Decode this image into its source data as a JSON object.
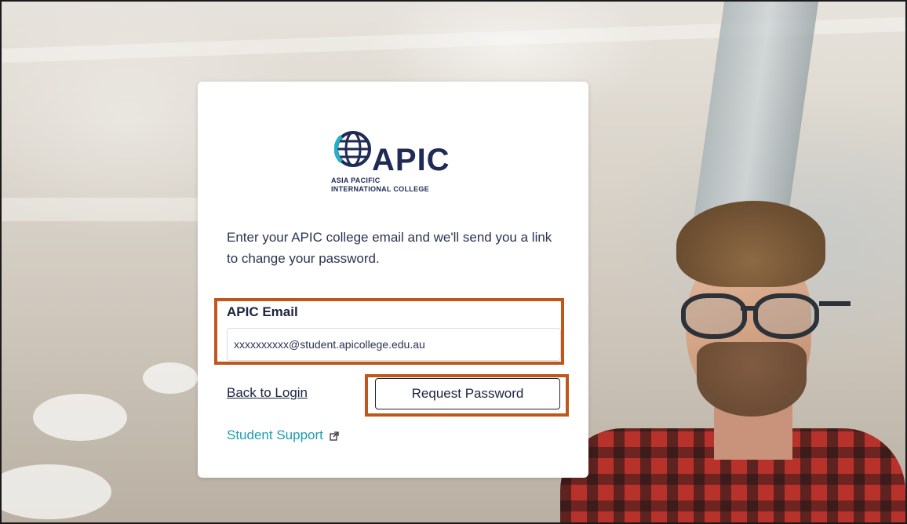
{
  "logo": {
    "wordmark": "APIC",
    "line1": "ASIA PACIFIC",
    "line2": "INTERNATIONAL COLLEGE",
    "icon": "globe-icon"
  },
  "instructions": "Enter your APIC college email and we'll send you a link to change your password.",
  "form": {
    "email_label": "APIC Email",
    "email_value": "xxxxxxxxxx@student.apicollege.edu.au"
  },
  "links": {
    "back_to_login": "Back to Login",
    "student_support": "Student Support",
    "external_icon": "external-link-icon"
  },
  "buttons": {
    "request_password": "Request Password"
  },
  "colors": {
    "brand_navy": "#1f2a55",
    "link_teal": "#1e9bb5",
    "highlight_orange": "#c1561a"
  }
}
